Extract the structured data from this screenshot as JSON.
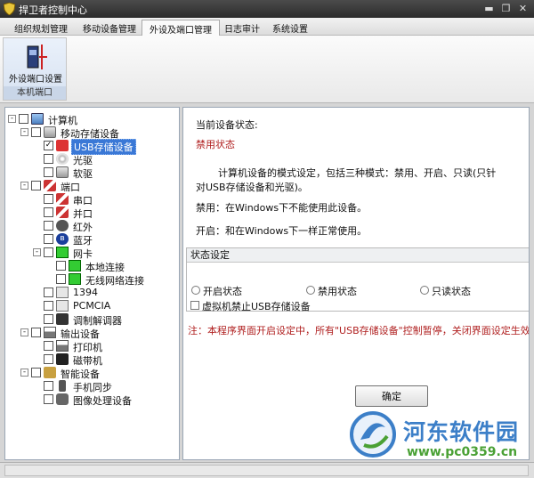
{
  "window": {
    "title": "捍卫者控制中心",
    "min_glyph": "▬",
    "restore_glyph": "❐",
    "close_glyph": "✕"
  },
  "menu": {
    "tabs": [
      {
        "label": "组织规划管理"
      },
      {
        "label": "移动设备管理"
      },
      {
        "label": "外设及端口管理",
        "active": true
      },
      {
        "label": "日志审计"
      },
      {
        "label": "系统设置"
      }
    ]
  },
  "ribbon": {
    "button_label": "外设端口设置",
    "group_label": "本机端口"
  },
  "tree": {
    "nodes": [
      {
        "label": "计算机",
        "icon": "computer-icon",
        "level": 0,
        "expander": "-",
        "checked": false
      },
      {
        "label": "移动存储设备",
        "icon": "drive-icon",
        "level": 1,
        "expander": "-",
        "checked": false
      },
      {
        "label": "USB存储设备",
        "icon": "usb-icon",
        "level": 2,
        "checked": true,
        "selected": true
      },
      {
        "label": "光驱",
        "icon": "cd-icon",
        "level": 2,
        "checked": false
      },
      {
        "label": "软驱",
        "icon": "floppy-icon",
        "level": 2,
        "checked": false
      },
      {
        "label": "端口",
        "icon": "port-icon",
        "level": 1,
        "expander": "-",
        "checked": false
      },
      {
        "label": "串口",
        "icon": "port-icon",
        "level": 2,
        "checked": false
      },
      {
        "label": "并口",
        "icon": "port-icon",
        "level": 2,
        "checked": false
      },
      {
        "label": "红外",
        "icon": "infrared-icon",
        "level": 2,
        "checked": false
      },
      {
        "label": "蓝牙",
        "icon": "bluetooth-icon",
        "level": 2,
        "checked": false
      },
      {
        "label": "网卡",
        "icon": "network-card-icon",
        "level": 2,
        "expander": "-",
        "checked": false
      },
      {
        "label": "本地连接",
        "icon": "network-card-icon",
        "level": 3,
        "checked": false
      },
      {
        "label": "无线网络连接",
        "icon": "network-card-icon",
        "level": 3,
        "checked": false
      },
      {
        "label": "1394",
        "icon": "card-icon",
        "level": 2,
        "checked": false
      },
      {
        "label": "PCMCIA",
        "icon": "card-icon",
        "level": 2,
        "checked": false
      },
      {
        "label": "调制解调器",
        "icon": "modem-icon",
        "level": 2,
        "checked": false
      },
      {
        "label": "输出设备",
        "icon": "printer-icon",
        "level": 1,
        "expander": "-",
        "checked": false
      },
      {
        "label": "打印机",
        "icon": "printer-icon",
        "level": 2,
        "checked": false
      },
      {
        "label": "磁带机",
        "icon": "tape-icon",
        "level": 2,
        "checked": false
      },
      {
        "label": "智能设备",
        "icon": "smart-device-icon",
        "level": 1,
        "expander": "-",
        "checked": false
      },
      {
        "label": "手机同步",
        "icon": "phone-icon",
        "level": 2,
        "checked": false
      },
      {
        "label": "图像处理设备",
        "icon": "camera-icon",
        "level": 2,
        "checked": false
      }
    ]
  },
  "panel": {
    "current_label": "当前设备状态:",
    "current_value": "禁用状态",
    "desc_line1": "计算机设备的模式设定，包括三种模式：禁用、开启、只读(只针",
    "desc_line2": "对USB存储设备和光驱)。",
    "disable_desc": "禁用：在Windows下不能使用此设备。",
    "enable_desc": "开启：和在Windows下一样正常使用。",
    "group_title": "状态设定",
    "radio_on": "开启状态",
    "radio_disabled": "禁用状态",
    "radio_readonly": "只读状态",
    "vm_checkbox": "虚拟机禁止USB存储设备",
    "note": "注：本程序界面开启设定中，所有\"USB存储设备\"控制暂停，关闭界面设定生效",
    "ok_button": "确定"
  },
  "watermark": {
    "name": "河东软件园",
    "url": "www.pc0359.cn"
  },
  "colors": {
    "selection": "#3a78d6",
    "status_red": "#b02020",
    "watermark_blue": "#3c7fc8",
    "watermark_green": "#4aa135"
  }
}
